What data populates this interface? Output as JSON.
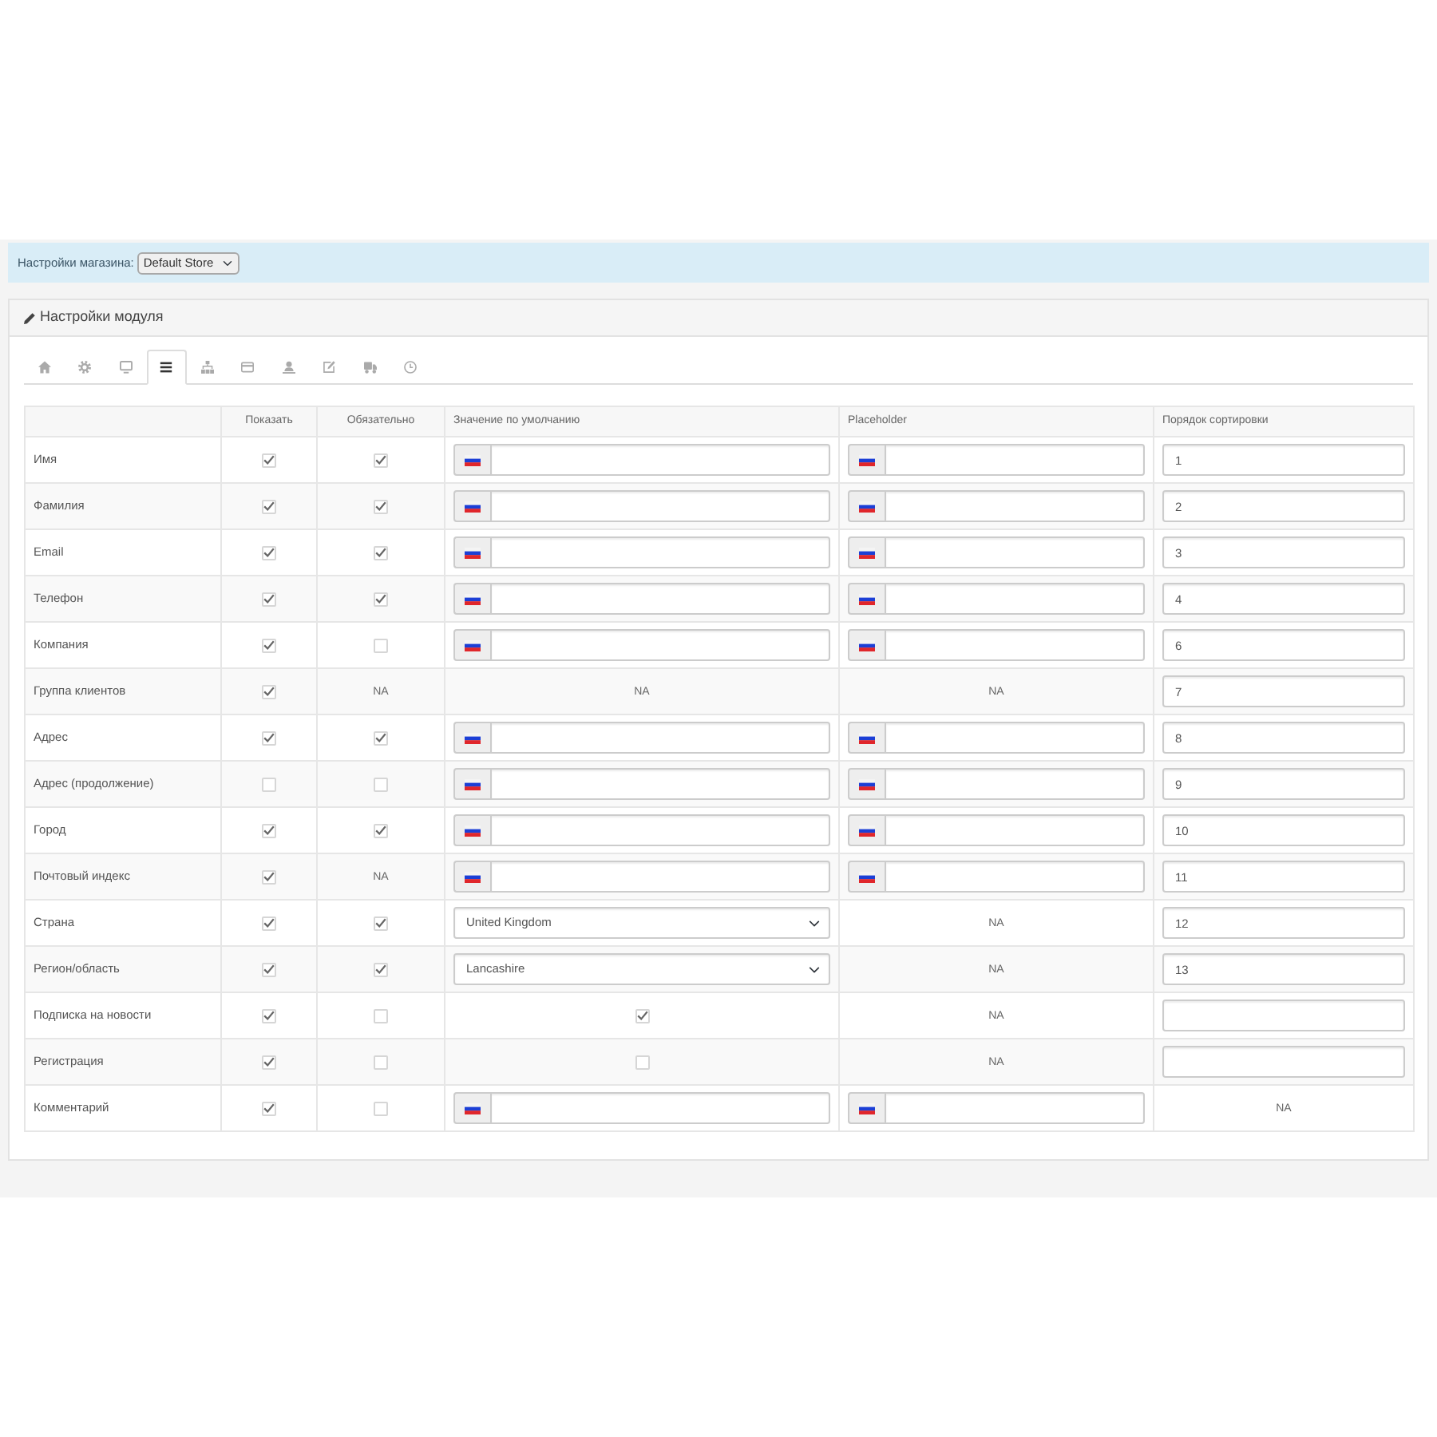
{
  "store_bar": {
    "label": "Настройки магазина:",
    "store_select": "Default Store"
  },
  "panel": {
    "title": "Настройки модуля",
    "tabs": [
      {
        "kind": "home",
        "selected": false
      },
      {
        "kind": "gear",
        "selected": false
      },
      {
        "kind": "monitor",
        "selected": false
      },
      {
        "kind": "list",
        "selected": true
      },
      {
        "kind": "hierarchy",
        "selected": false
      },
      {
        "kind": "card",
        "selected": false
      },
      {
        "kind": "person",
        "selected": false
      },
      {
        "kind": "edit",
        "selected": false
      },
      {
        "kind": "truck",
        "selected": false
      },
      {
        "kind": "clock",
        "selected": false
      }
    ],
    "table": {
      "columns": [
        "Показать",
        "Обязательно",
        "Значение по умолчанию",
        "Placeholder",
        "Порядок сортировки"
      ],
      "rows": [
        {
          "label": "Имя",
          "cells": [
            {
              "kind": "checkbox",
              "checked": true
            },
            {
              "kind": "checkbox",
              "checked": true
            },
            {
              "kind": "lang_input"
            },
            {
              "kind": "lang_input"
            },
            {
              "kind": "input",
              "value": "1"
            }
          ]
        },
        {
          "label": "Фамилия",
          "cells": [
            {
              "kind": "checkbox",
              "checked": true
            },
            {
              "kind": "checkbox",
              "checked": true
            },
            {
              "kind": "lang_input"
            },
            {
              "kind": "lang_input"
            },
            {
              "kind": "input",
              "value": "2"
            }
          ]
        },
        {
          "label": "Email",
          "cells": [
            {
              "kind": "checkbox",
              "checked": true
            },
            {
              "kind": "checkbox",
              "checked": true
            },
            {
              "kind": "lang_input"
            },
            {
              "kind": "lang_input"
            },
            {
              "kind": "input",
              "value": "3"
            }
          ]
        },
        {
          "label": "Телефон",
          "cells": [
            {
              "kind": "checkbox",
              "checked": true
            },
            {
              "kind": "checkbox",
              "checked": true
            },
            {
              "kind": "lang_input"
            },
            {
              "kind": "lang_input"
            },
            {
              "kind": "input",
              "value": "4"
            }
          ]
        },
        {
          "label": "Компания",
          "cells": [
            {
              "kind": "checkbox",
              "checked": true
            },
            {
              "kind": "checkbox",
              "checked": false
            },
            {
              "kind": "lang_input"
            },
            {
              "kind": "lang_input"
            },
            {
              "kind": "input",
              "value": "6"
            }
          ]
        },
        {
          "label": "Группа клиентов",
          "cells": [
            {
              "kind": "checkbox",
              "checked": true
            },
            {
              "kind": "text",
              "text": "NA"
            },
            {
              "kind": "text",
              "text": "NA"
            },
            {
              "kind": "text",
              "text": "NA"
            },
            {
              "kind": "input",
              "value": "7"
            }
          ]
        },
        {
          "label": "Адрес",
          "cells": [
            {
              "kind": "checkbox",
              "checked": true
            },
            {
              "kind": "checkbox",
              "checked": true
            },
            {
              "kind": "lang_input"
            },
            {
              "kind": "lang_input"
            },
            {
              "kind": "input",
              "value": "8"
            }
          ]
        },
        {
          "label": "Адрес (продолжение)",
          "cells": [
            {
              "kind": "checkbox",
              "checked": false
            },
            {
              "kind": "checkbox",
              "checked": false
            },
            {
              "kind": "lang_input"
            },
            {
              "kind": "lang_input"
            },
            {
              "kind": "input",
              "value": "9"
            }
          ]
        },
        {
          "label": "Город",
          "cells": [
            {
              "kind": "checkbox",
              "checked": true
            },
            {
              "kind": "checkbox",
              "checked": true
            },
            {
              "kind": "lang_input"
            },
            {
              "kind": "lang_input"
            },
            {
              "kind": "input",
              "value": "10"
            }
          ]
        },
        {
          "label": "Почтовый индекс",
          "cells": [
            {
              "kind": "checkbox",
              "checked": true
            },
            {
              "kind": "text",
              "text": "NA"
            },
            {
              "kind": "lang_input"
            },
            {
              "kind": "lang_input"
            },
            {
              "kind": "input",
              "value": "11"
            }
          ]
        },
        {
          "label": "Страна",
          "cells": [
            {
              "kind": "checkbox",
              "checked": true
            },
            {
              "kind": "checkbox",
              "checked": true
            },
            {
              "kind": "select",
              "value": "United Kingdom"
            },
            {
              "kind": "text",
              "text": "NA"
            },
            {
              "kind": "input",
              "value": "12"
            }
          ]
        },
        {
          "label": "Регион/область",
          "cells": [
            {
              "kind": "checkbox",
              "checked": true
            },
            {
              "kind": "checkbox",
              "checked": true
            },
            {
              "kind": "select",
              "value": "Lancashire"
            },
            {
              "kind": "text",
              "text": "NA"
            },
            {
              "kind": "input",
              "value": "13"
            }
          ]
        },
        {
          "label": "Подписка на новости",
          "cells": [
            {
              "kind": "checkbox",
              "checked": true
            },
            {
              "kind": "checkbox",
              "checked": false
            },
            {
              "kind": "checkbox",
              "checked": true
            },
            {
              "kind": "text",
              "text": "NA"
            },
            {
              "kind": "input"
            }
          ]
        },
        {
          "label": "Регистрация",
          "cells": [
            {
              "kind": "checkbox",
              "checked": true
            },
            {
              "kind": "checkbox",
              "checked": false
            },
            {
              "kind": "checkbox",
              "checked": false
            },
            {
              "kind": "text",
              "text": "NA"
            },
            {
              "kind": "input"
            }
          ]
        },
        {
          "label": "Комментарий",
          "cells": [
            {
              "kind": "checkbox",
              "checked": true
            },
            {
              "kind": "checkbox",
              "checked": false
            },
            {
              "kind": "lang_input"
            },
            {
              "kind": "lang_input"
            },
            {
              "kind": "text",
              "text": "NA"
            }
          ]
        }
      ]
    }
  }
}
